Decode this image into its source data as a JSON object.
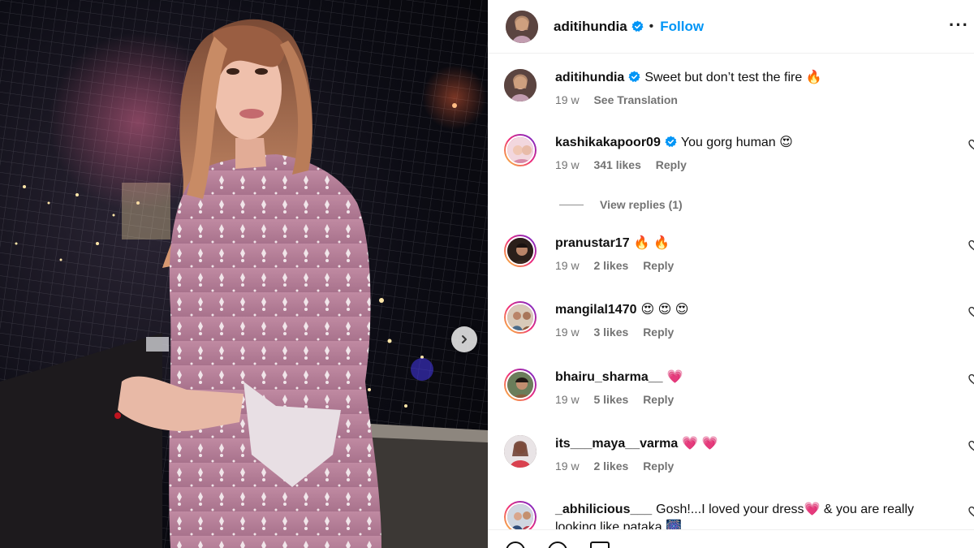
{
  "post": {
    "author": "aditihundia",
    "follow_label": "Follow",
    "separator": "•",
    "more_label": "···"
  },
  "caption": {
    "user": "aditihundia",
    "text": "Sweet but don’t test the fire 🔥",
    "time": "19 w",
    "translation": "See Translation"
  },
  "comments": [
    {
      "user": "kashikakapoor09",
      "text": "You gorg human 😍",
      "time": "19 w",
      "likes": "341 likes",
      "reply": "Reply",
      "verified": true
    },
    {
      "user": "pranustar17",
      "text": "🔥 🔥",
      "time": "19 w",
      "likes": "2 likes",
      "reply": "Reply"
    },
    {
      "user": "mangilal1470",
      "text": "😍 😍 😍",
      "time": "19 w",
      "likes": "3 likes",
      "reply": "Reply"
    },
    {
      "user": "bhairu_sharma__",
      "text": "💗",
      "time": "19 w",
      "likes": "5 likes",
      "reply": "Reply"
    },
    {
      "user": "its___maya__varma",
      "text": "💗 💗",
      "time": "19 w",
      "likes": "2 likes",
      "reply": "Reply"
    },
    {
      "user": "_abhilicious___",
      "text": "Gosh!...I loved your dress💗  & you are really",
      "text2": "looking like pataka 🎆"
    }
  ],
  "view_replies": "View replies (1)",
  "colors": {
    "accent": "#0095f6",
    "verified": "#0095f6",
    "meta": "#737373"
  }
}
